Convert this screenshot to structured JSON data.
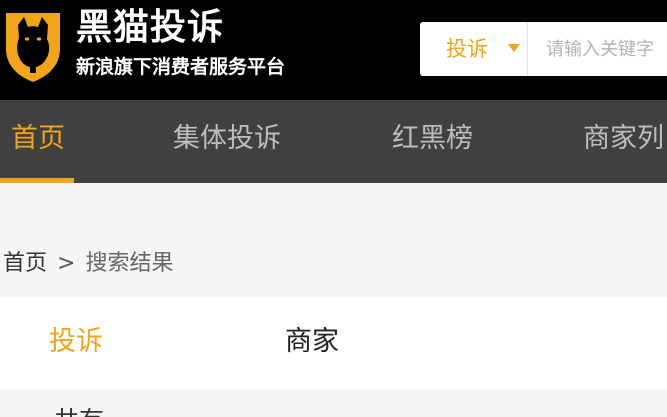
{
  "brand": {
    "title": "黑猫投诉",
    "subtitle": "新浪旗下消费者服务平台",
    "logo_icon": "black-cat-shield-icon",
    "accent_color": "#f0a51b"
  },
  "search": {
    "type_label": "投诉",
    "placeholder": "请输入关键字",
    "value": ""
  },
  "nav": {
    "items": [
      {
        "label": "首页",
        "active": true
      },
      {
        "label": "集体投诉",
        "active": false
      },
      {
        "label": "红黑榜",
        "active": false
      },
      {
        "label": "商家列",
        "active": false
      }
    ]
  },
  "breadcrumb": {
    "home": "首页",
    "separator": ">",
    "current": "搜索结果"
  },
  "tabs": {
    "items": [
      {
        "label": "投诉",
        "active": true
      },
      {
        "label": "商家",
        "active": false
      }
    ]
  },
  "results": {
    "partial_text": "共有",
    "partial_highlight": ""
  }
}
